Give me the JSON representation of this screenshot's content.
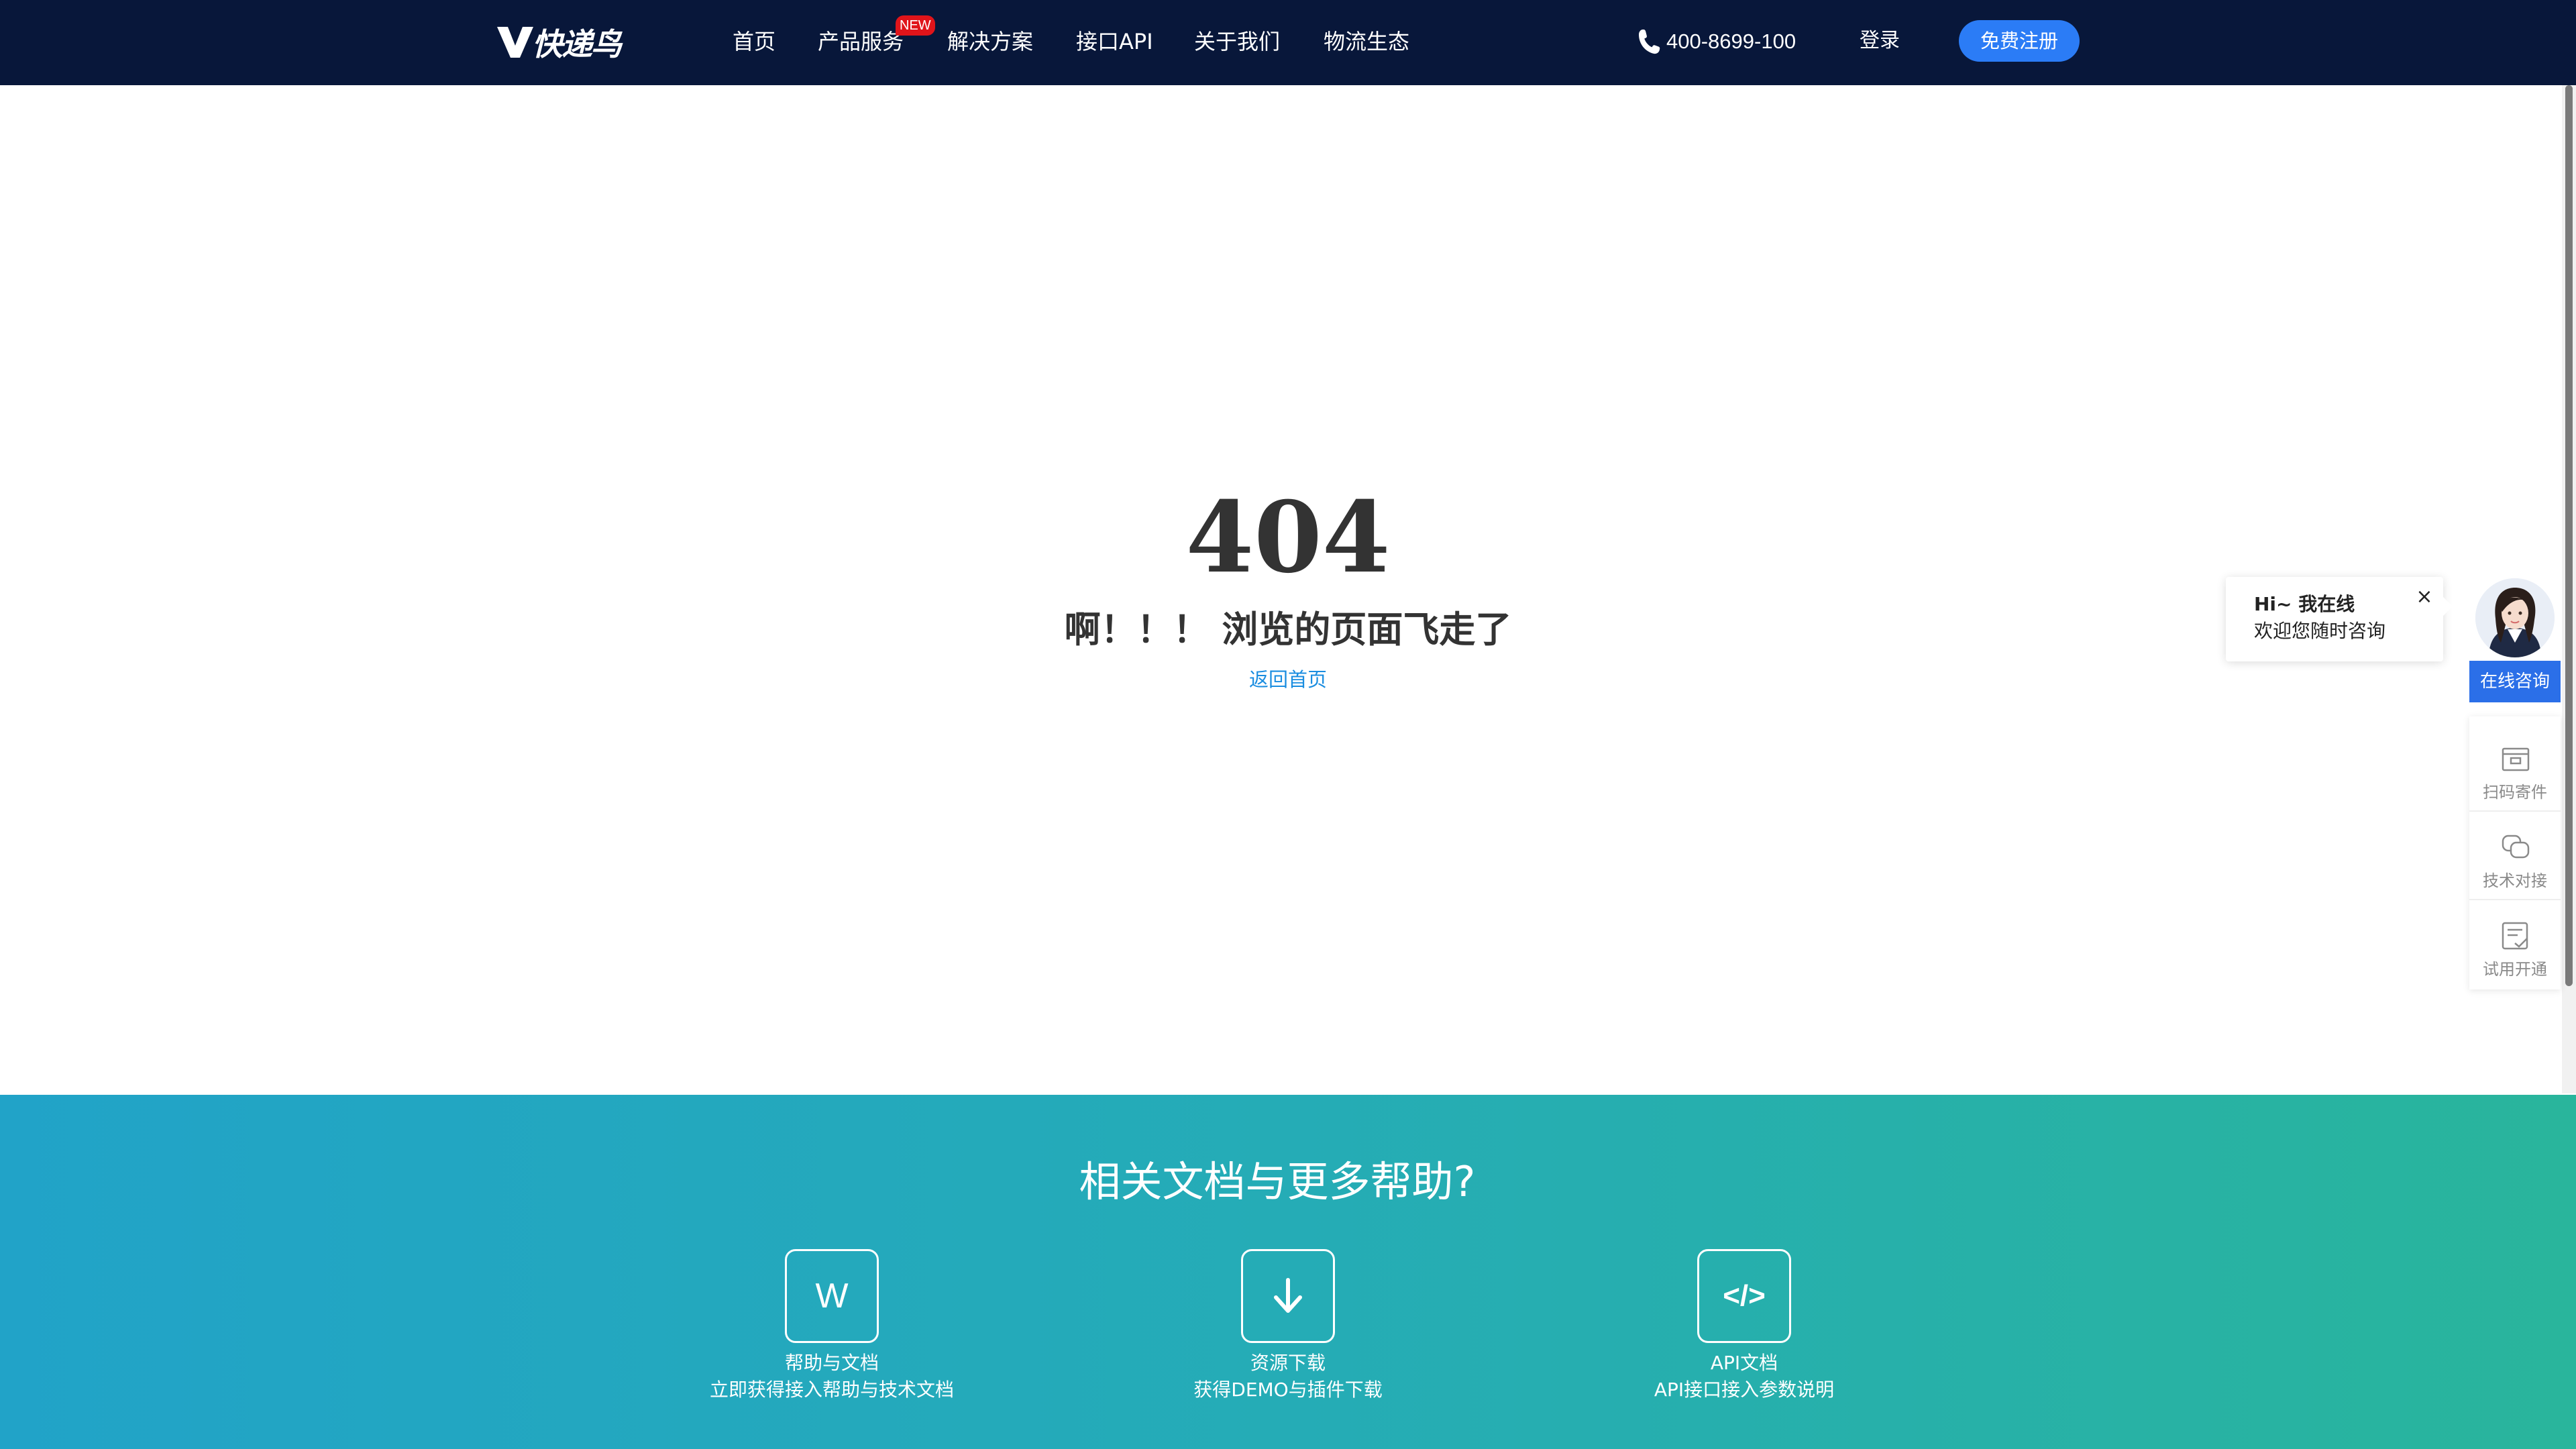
{
  "header": {
    "logo_text": "快递鸟",
    "nav": [
      {
        "label": "首页"
      },
      {
        "label": "产品服务",
        "badge": "NEW"
      },
      {
        "label": "解决方案"
      },
      {
        "label": "接口API"
      },
      {
        "label": "关于我们"
      },
      {
        "label": "物流生态"
      }
    ],
    "phone": "400-8699-100",
    "login": "登录",
    "register": "免费注册"
  },
  "error": {
    "code": "404",
    "message": "啊！！！ 浏览的页面飞走了",
    "back_link": "返回首页"
  },
  "help": {
    "title": "相关文档与更多帮助?",
    "cards": [
      {
        "icon": "w-document-icon",
        "icon_glyph": "W",
        "title": "帮助与文档",
        "desc": "立即获得接入帮助与技术文档"
      },
      {
        "icon": "download-arrow-icon",
        "title": "资源下载",
        "desc": "获得DEMO与插件下载"
      },
      {
        "icon": "code-brackets-icon",
        "icon_glyph": "</>",
        "title": "API文档",
        "desc": "API接口接入参数说明"
      }
    ]
  },
  "float_widget": {
    "bubble_hi": "Hi~ 我在线",
    "bubble_welcome": "欢迎您随时咨询",
    "close_glyph": "×",
    "consult_button": "在线咨询",
    "items": [
      {
        "label": "扫码寄件",
        "icon": "scan-box-icon"
      },
      {
        "label": "技术对接",
        "icon": "chat-bubbles-icon"
      },
      {
        "label": "试用开通",
        "icon": "document-check-icon"
      }
    ]
  },
  "colors": {
    "header_bg": "#08173a",
    "accent_blue": "#2b7cf6",
    "link_blue": "#1a8de0",
    "badge_red": "#e0141a",
    "band_start": "#21a3c8",
    "band_end": "#29b59c"
  }
}
